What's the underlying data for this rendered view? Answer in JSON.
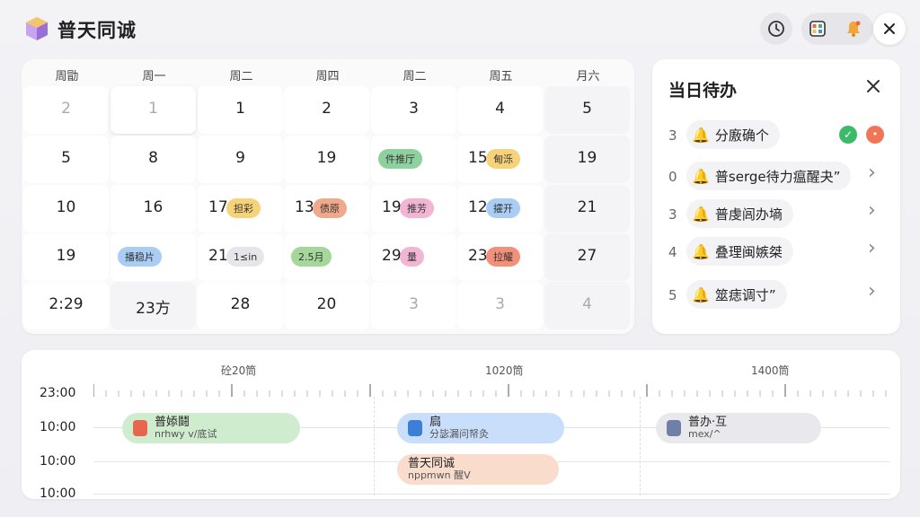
{
  "app": {
    "title": "普天同诚"
  },
  "header_icons": [
    "clock-icon",
    "calendar-grid-icon",
    "bell-icon",
    "close-icon"
  ],
  "calendar": {
    "weekdays": [
      "周勖",
      "周一",
      "周二",
      "周四",
      "周二",
      "周五",
      "月六"
    ],
    "weeks": [
      [
        {
          "d": "2",
          "muted": true
        },
        {
          "d": "1",
          "muted": true,
          "today": true
        },
        {
          "d": "1"
        },
        {
          "d": "2"
        },
        {
          "d": "3"
        },
        {
          "d": "4"
        },
        {
          "d": "5",
          "dim": true
        }
      ],
      [
        {
          "d": "5"
        },
        {
          "d": "8"
        },
        {
          "d": "9"
        },
        {
          "d": "19"
        },
        {
          "d": "",
          "event": {
            "label": "件推厅",
            "color": "#8fd19e"
          }
        },
        {
          "d": "15",
          "event": {
            "label": "甸泺",
            "color": "#f6d27a"
          }
        },
        {
          "d": "19",
          "dim": true
        }
      ],
      [
        {
          "d": "10"
        },
        {
          "d": "16"
        },
        {
          "d": "17",
          "event": {
            "label": "担彩",
            "color": "#f6d27a"
          }
        },
        {
          "d": "13",
          "event": {
            "label": "债原",
            "color": "#f0a98c"
          }
        },
        {
          "d": "19",
          "event": {
            "label": "推芳",
            "color": "#f2b6d4"
          }
        },
        {
          "d": "12",
          "event": {
            "label": "攉开",
            "color": "#a9cdf4"
          }
        },
        {
          "d": "21",
          "dim": true
        }
      ],
      [
        {
          "d": "19"
        },
        {
          "d": "",
          "event": {
            "label": "播稳片",
            "color": "#a9cdf4"
          }
        },
        {
          "d": "21",
          "event": {
            "label": "1≤in",
            "color": "#e6e6ea"
          }
        },
        {
          "d": "",
          "event": {
            "label": "2.5月",
            "color": "#a5d79a"
          }
        },
        {
          "d": "29",
          "event": {
            "label": "量",
            "color": "#f2b6d4"
          }
        },
        {
          "d": "23",
          "event": {
            "label": "拉耀",
            "color": "#f3907a"
          }
        },
        {
          "d": "27",
          "dim": true
        }
      ],
      [
        {
          "d": "2:29"
        },
        {
          "d": "23方",
          "dim": true
        },
        {
          "d": "28"
        },
        {
          "d": "20"
        },
        {
          "d": "3",
          "muted": true
        },
        {
          "d": "3",
          "muted": true
        },
        {
          "d": "4",
          "muted": true,
          "dim": true
        }
      ]
    ]
  },
  "todo": {
    "title": "当日待办",
    "items": [
      {
        "num": "3",
        "label": "分廒确个",
        "action": "check"
      },
      {
        "num": "0",
        "label": "普serge待力瘟醒夬”",
        "action": "chevron"
      },
      {
        "num": "3",
        "label": "普虔闾办墒",
        "action": "chevron"
      },
      {
        "num": "4",
        "label": "叠理闽嫉桀",
        "action": "chevron"
      },
      {
        "num": "5",
        "label": "筮痣调寸”",
        "action": "chevron"
      }
    ]
  },
  "timeline": {
    "columns": [
      "砼20筒",
      "1020筒",
      "1400筒"
    ],
    "rows": [
      "23:00",
      "10:00",
      "10:00",
      "10:00"
    ],
    "events": [
      {
        "title": "普婖鬪",
        "sub": "nrhwy v/底试",
        "color": "#cfeccf",
        "icon_color": "#e8664e"
      },
      {
        "title": "扃",
        "sub": "分毖漏问帑灸",
        "color": "#c9defa",
        "icon_color": "#3d7fd6"
      },
      {
        "title": "普天同诚",
        "sub": "nppmwn 醒V",
        "color": "#fadccd",
        "icon_color": ""
      },
      {
        "title": "普办·互",
        "sub": "mex/^",
        "color": "#e9e9ed",
        "icon_color": "#6f7fa8"
      }
    ]
  }
}
